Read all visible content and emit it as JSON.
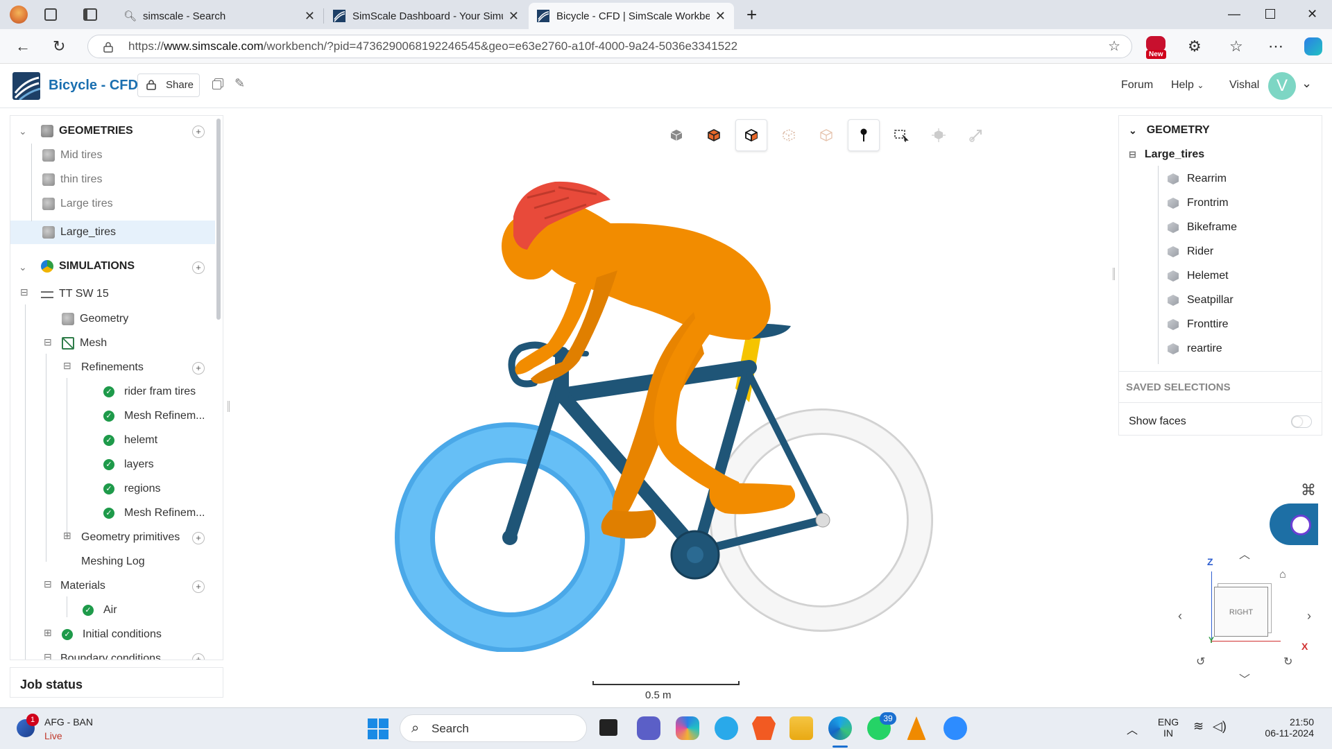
{
  "browser": {
    "tabs": [
      {
        "title": "simscale - Search",
        "active": false
      },
      {
        "title": "SimScale Dashboard - Your Simula",
        "active": false
      },
      {
        "title": "Bicycle - CFD | SimScale Workben",
        "active": true
      }
    ],
    "url_prefix": "https://",
    "url_domain": "www.simscale.com",
    "url_path": "/workbench/?pid=4736290068192246545&geo=e63e2760-a10f-4000-9a24-5036e3341522",
    "new_badge": "New"
  },
  "header": {
    "title": "Bicycle - CFD",
    "share": "Share",
    "forum": "Forum",
    "help": "Help",
    "user": "Vishal",
    "avatar_letter": "V"
  },
  "left": {
    "geometries_title": "GEOMETRIES",
    "geometries": [
      "Mid tires",
      "thin tires",
      "Large tires",
      "Large_tires"
    ],
    "simulations_title": "SIMULATIONS",
    "sim_name": "TT SW 15",
    "geometry": "Geometry",
    "mesh": "Mesh",
    "refinements": "Refinements",
    "refinement_items": [
      "rider fram tires",
      "Mesh Refinem...",
      "helemt",
      "layers",
      "regions",
      "Mesh Refinem..."
    ],
    "geometry_primitives": "Geometry primitives",
    "meshing_log": "Meshing Log",
    "materials": "Materials",
    "air": "Air",
    "initial_conditions": "Initial conditions",
    "boundary_conditions": "Boundary conditions",
    "job_status": "Job status"
  },
  "right": {
    "title": "GEOMETRY",
    "root": "Large_tires",
    "parts": [
      "Rearrim",
      "Frontrim",
      "Bikeframe",
      "Rider",
      "Helemet",
      "Seatpillar",
      "Fronttire",
      "reartire"
    ],
    "saved_selections": "SAVED SELECTIONS",
    "show_faces": "Show faces",
    "show_faces_on": false
  },
  "viewport": {
    "scale_label": "0.5 m",
    "nav_face": "RIGHT",
    "axis_z": "Z",
    "axis_y": "Y",
    "axis_x": "X"
  },
  "taskbar": {
    "news_badge": "1",
    "news_title": "AFG - BAN",
    "news_sub": "Live",
    "search": "Search",
    "whatsapp_badge": "39",
    "lang1": "ENG",
    "lang2": "IN",
    "time": "21:50",
    "date": "06-11-2024"
  },
  "colors": {
    "brand": "#1a6fb0",
    "rider": "#f28c00",
    "helmet": "#e8483a",
    "frame": "#1f5577",
    "front_tire": "#5ab4ee",
    "rear_tire": "#f4f4f4",
    "seatpost": "#f5c400"
  }
}
